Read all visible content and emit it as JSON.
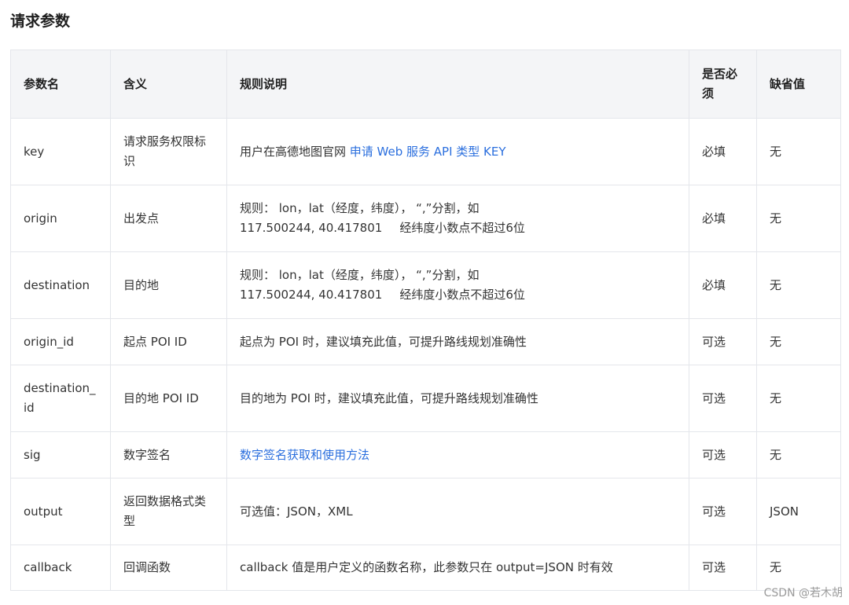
{
  "title": "请求参数",
  "headers": {
    "name": "参数名",
    "meaning": "含义",
    "rule": "规则说明",
    "required": "是否必须",
    "default": "缺省值"
  },
  "rows": [
    {
      "name": "key",
      "meaning": "请求服务权限标识",
      "rule_prefix": "用户在高德地图官网 ",
      "rule_link": "申请 Web 服务 API 类型 KEY",
      "required": "必填",
      "default": "无"
    },
    {
      "name": "origin",
      "meaning": "出发点",
      "rule_line1": "规则： lon，lat（经度，纬度）， “,”分割，如",
      "rule_coord": "117.500244, 40.417801",
      "rule_note": "经纬度小数点不超过6位",
      "required": "必填",
      "default": "无"
    },
    {
      "name": "destination",
      "meaning": "目的地",
      "rule_line1": "规则： lon，lat（经度，纬度）， “,”分割，如",
      "rule_coord": "117.500244, 40.417801",
      "rule_note": "经纬度小数点不超过6位",
      "required": "必填",
      "default": "无"
    },
    {
      "name": "origin_id",
      "meaning": "起点 POI ID",
      "rule": "起点为 POI 时，建议填充此值，可提升路线规划准确性",
      "required": "可选",
      "default": "无"
    },
    {
      "name": "destination_id",
      "meaning": "目的地 POI ID",
      "rule": "目的地为 POI 时，建议填充此值，可提升路线规划准确性",
      "required": "可选",
      "default": "无"
    },
    {
      "name": "sig",
      "meaning": "数字签名",
      "rule_link": "数字签名获取和使用方法",
      "required": "可选",
      "default": "无"
    },
    {
      "name": "output",
      "meaning": "返回数据格式类型",
      "rule": "可选值：JSON，XML",
      "required": "可选",
      "default": "JSON"
    },
    {
      "name": "callback",
      "meaning": "回调函数",
      "rule": "callback 值是用户定义的函数名称，此参数只在 output=JSON 时有效",
      "required": "可选",
      "default": "无"
    }
  ],
  "watermark": "CSDN @若木胡"
}
